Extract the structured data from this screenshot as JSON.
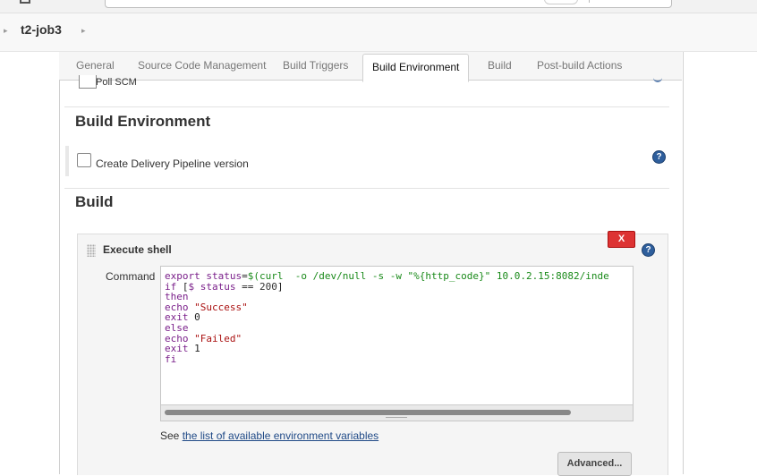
{
  "breadcrumb": {
    "job": "t2-job3"
  },
  "tabs": [
    {
      "label": "General"
    },
    {
      "label": "Source Code Management"
    },
    {
      "label": "Build Triggers"
    },
    {
      "label": "Build Environment",
      "active": true
    },
    {
      "label": "Build"
    },
    {
      "label": "Post-build Actions"
    }
  ],
  "build_triggers": {
    "poll_scm_label": "Poll SCM"
  },
  "build_environment": {
    "title": "Build Environment",
    "delivery_pipeline_label": "Create Delivery Pipeline version",
    "help": "?"
  },
  "build": {
    "title": "Build",
    "step": {
      "title": "Execute shell",
      "delete_label": "X",
      "help": "?",
      "command_label": "Command",
      "command_lines": [
        "export status=$(curl  -o /dev/null -s -w \"%{http_code}\" 10.0.2.15:8082/inde",
        "if [$ status == 200]",
        "then",
        "echo \"Success\"",
        "exit 0",
        "else",
        "echo \"Failed\"",
        "exit 1",
        "fi"
      ],
      "see_prefix": "See",
      "see_link": "the list of available environment variables",
      "advanced_label": "Advanced..."
    }
  },
  "colors": {
    "accent": "#2e5e9c",
    "delete": "#dd3333"
  }
}
